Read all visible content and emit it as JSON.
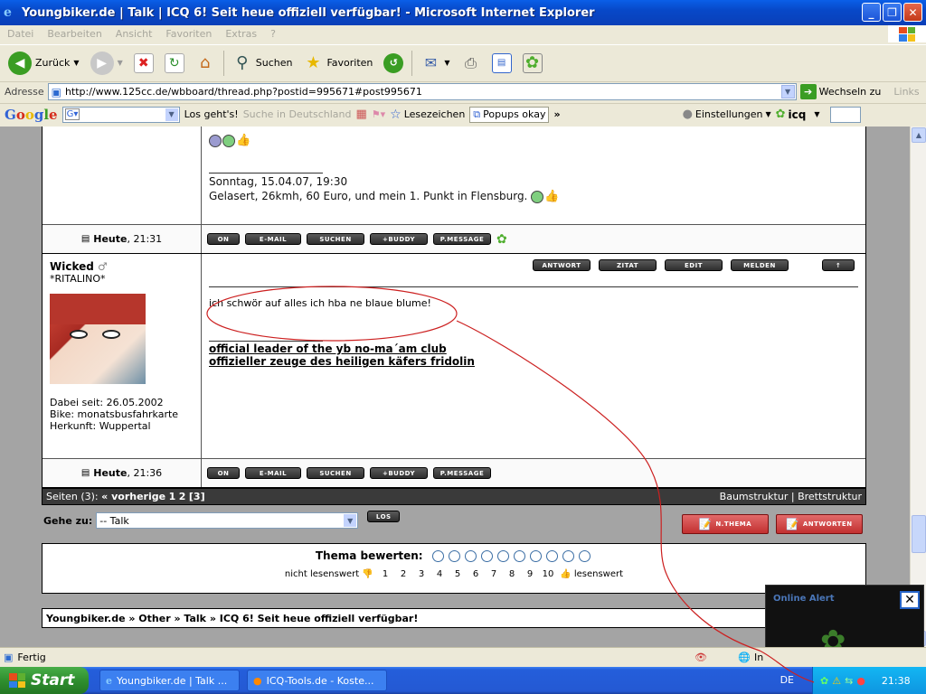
{
  "window": {
    "title": "Youngbiker.de | Talk | ICQ 6! Seit heue offiziell verfügbar! - Microsoft Internet Explorer"
  },
  "menu": [
    "Datei",
    "Bearbeiten",
    "Ansicht",
    "Favoriten",
    "Extras",
    "?"
  ],
  "toolbar": {
    "back": "Zurück",
    "search": "Suchen",
    "favorites": "Favoriten"
  },
  "address": {
    "label": "Adresse",
    "url": "http://www.125cc.de/wbboard/thread.php?postid=995671#post995671",
    "go": "Wechseln zu",
    "links": "Links"
  },
  "googlebar": {
    "logo": "Google",
    "search_btn": "Los geht's!",
    "search_de": "Suche in Deutschland",
    "bookmarks": "Lesezeichen",
    "popups": "Popups okay",
    "settings": "Einstellungen",
    "icq": "icq"
  },
  "post1": {
    "date_line": "Sonntag, 15.04.07, 19:30",
    "text_line": "Gelasert, 26kmh, 60 Euro, und mein 1. Punkt in Flensburg.",
    "time_label": "Heute",
    "time": ", 21:31",
    "buttons": [
      "ON",
      "E-MAIL",
      "SUCHEN",
      "+BUDDY",
      "P.MESSAGE"
    ]
  },
  "post2": {
    "author": "Wicked",
    "gender_symbol": "♂",
    "rank": "*RITALINO*",
    "actions": [
      "ANTWORT",
      "ZITAT",
      "EDIT",
      "MELDEN",
      "↑"
    ],
    "message": "ich schwör auf alles ich hba ne blaue blume!",
    "sig_line1": "official leader of the yb no-ma´am club",
    "sig_line2": "offizieller zeuge des heiligen käfers fridolin",
    "joined": "Dabei seit: 26.05.2002",
    "bike": "Bike: monatsbusfahrkarte",
    "origin": "Herkunft: Wuppertal",
    "time_label": "Heute",
    "time": ", 21:36",
    "buttons": [
      "ON",
      "E-MAIL",
      "SUCHEN",
      "+BUDDY",
      "P.MESSAGE"
    ]
  },
  "pager": {
    "label": "Seiten (3):",
    "prev": "« vorherige",
    "p1": "1",
    "p2": "2",
    "current": "[3]",
    "tree": "Baumstruktur",
    "board": "Brettstruktur"
  },
  "goto": {
    "label": "Gehe zu:",
    "selected": "-- Talk",
    "go": "LOS",
    "new_thread": "N.THEMA",
    "reply": "ANTWORTEN"
  },
  "rating": {
    "label": "Thema bewerten:",
    "low": "nicht lesenswert",
    "high": "lesenswert",
    "scale": [
      "1",
      "2",
      "3",
      "4",
      "5",
      "6",
      "7",
      "8",
      "9",
      "10"
    ]
  },
  "breadcrumb": "Youngbiker.de » Other » Talk » ICQ 6! Seit heue offiziell verfügbar!",
  "alert": {
    "title": "Online Alert"
  },
  "status": {
    "text": "Fertig",
    "zone": "In"
  },
  "taskbar": {
    "start": "Start",
    "task1": "Youngbiker.de | Talk ...",
    "task2": "ICQ-Tools.de - Koste...",
    "lang": "DE",
    "clock": "21:38"
  },
  "colors": {
    "annotation": "#cc2020",
    "xp_blue": "#245edb"
  }
}
